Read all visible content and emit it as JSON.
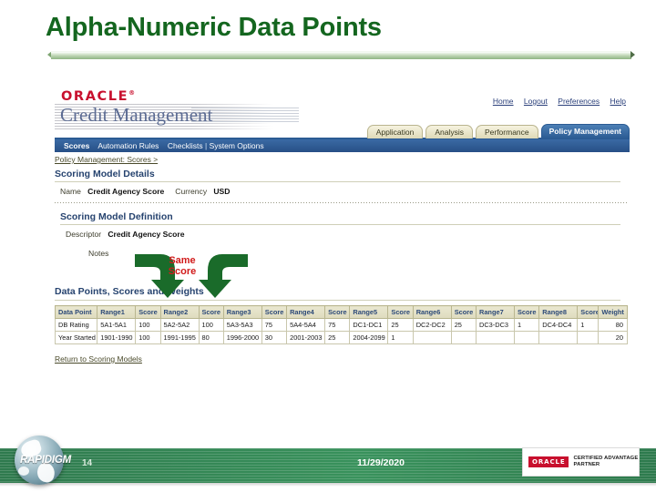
{
  "slide": {
    "title": "Alpha-Numeric Data Points"
  },
  "app": {
    "brand": "ORACLE",
    "product": "Credit Management",
    "global_links": [
      {
        "label": "Home"
      },
      {
        "label": "Logout"
      },
      {
        "label": "Preferences"
      },
      {
        "label": "Help"
      }
    ],
    "tabs": [
      {
        "label": "Application",
        "active": false
      },
      {
        "label": "Analysis",
        "active": false
      },
      {
        "label": "Performance",
        "active": false
      },
      {
        "label": "Policy Management",
        "active": true
      }
    ],
    "subnav": {
      "current": "Scores",
      "items": [
        "Automation Rules",
        "Checklists",
        "System Options"
      ],
      "separator": "|"
    },
    "breadcrumb": "Policy Management: Scores  >",
    "page_heading": "Scoring Model Details",
    "model": {
      "name_label": "Name",
      "name_value": "Credit Agency Score",
      "currency_label": "Currency",
      "currency_value": "USD"
    },
    "definition": {
      "heading": "Scoring Model Definition",
      "descriptor_label": "Descriptor",
      "descriptor_value": "Credit Agency Score",
      "notes_label": "Notes",
      "notes_value": ""
    },
    "datapoints": {
      "heading": "Data Points, Scores and Weights",
      "columns": [
        "Data Point",
        "Range1",
        "Score",
        "Range2",
        "Score",
        "Range3",
        "Score",
        "Range4",
        "Score",
        "Range5",
        "Score",
        "Range6",
        "Score",
        "Range7",
        "Score",
        "Range8",
        "Score",
        "Weight"
      ],
      "rows": [
        {
          "data_point": "DB Rating",
          "cells": [
            "5A1-5A1",
            "100",
            "5A2-5A2",
            "100",
            "5A3-5A3",
            "75",
            "5A4-5A4",
            "75",
            "DC1-DC1",
            "25",
            "DC2-DC2",
            "25",
            "DC3-DC3",
            "1",
            "DC4-DC4",
            "1"
          ],
          "weight": "80"
        },
        {
          "data_point": "Year Started",
          "cells": [
            "1901-1990",
            "100",
            "1991-1995",
            "80",
            "1996-2000",
            "30",
            "2001-2003",
            "25",
            "2004-2099",
            "1",
            "",
            "",
            "",
            "",
            "",
            ""
          ],
          "weight": "20"
        }
      ]
    },
    "return_link": "Return to Scoring Models"
  },
  "annotation": {
    "line1": "Same",
    "line2": "Score",
    "color": "#d11b1b",
    "arrow_color": "#1a6b2a"
  },
  "footer": {
    "logo_text": "RAPIDIGM",
    "page_number": "14",
    "date": "11/29/2020",
    "partner_brand": "ORACLE",
    "partner_line1": "CERTIFIED ADVANTAGE",
    "partner_line2": "PARTNER"
  }
}
